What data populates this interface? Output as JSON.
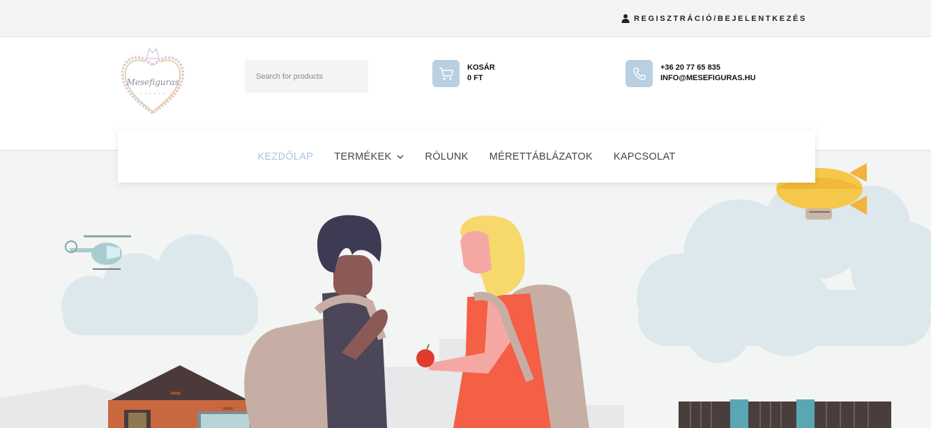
{
  "topbar": {
    "account_link": "REGISZTRÁCIÓ/BEJELENTKEZÉS",
    "account_icon": "user-icon"
  },
  "header": {
    "logo_alt": "Mesefiguras",
    "search": {
      "placeholder": "Search for products",
      "value": ""
    },
    "cart": {
      "label": "KOSÁR",
      "amount": "0 FT",
      "icon": "cart-icon"
    },
    "contact": {
      "phone": "+36 20 77 65 835",
      "email": "INFO@MESEFIGURAS.HU",
      "icon": "phone-icon"
    }
  },
  "nav": {
    "items": [
      {
        "label": "KEZDŐLAP",
        "active": true
      },
      {
        "label": "TERMÉKEK",
        "dropdown": true
      },
      {
        "label": "RÓLUNK"
      },
      {
        "label": "MÉRETTÁBLÁZATOK"
      },
      {
        "label": "KAPCSOLAT"
      }
    ]
  },
  "colors": {
    "accent": "#a9c5dd",
    "icon_box": "#b9cfe2",
    "background": "#f3f4f4"
  }
}
